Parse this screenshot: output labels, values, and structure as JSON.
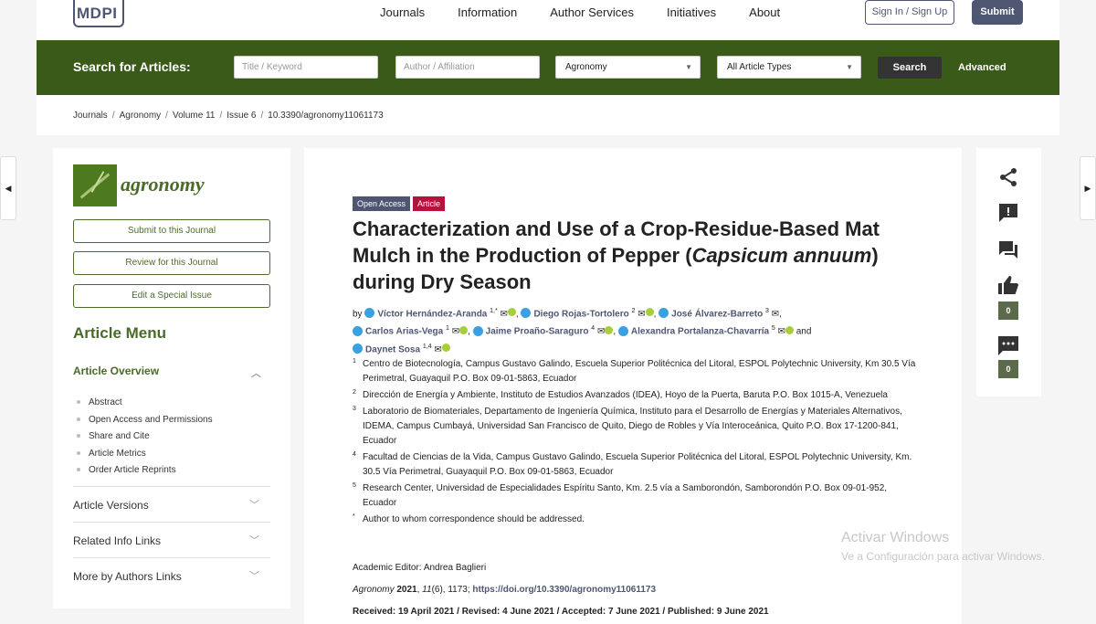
{
  "header": {
    "logo_text": "MDPI",
    "nav": [
      "Journals",
      "Information",
      "Author Services",
      "Initiatives",
      "About"
    ],
    "signin_label": "Sign In / Sign Up",
    "submit_label": "Submit"
  },
  "search": {
    "label": "Search for Articles:",
    "title_placeholder": "Title / Keyword",
    "author_placeholder": "Author / Affiliation",
    "journal_value": "Agronomy",
    "type_value": "All Article Types",
    "search_button": "Search",
    "advanced_link": "Advanced"
  },
  "breadcrumb": [
    "Journals",
    "Agronomy",
    "Volume 11",
    "Issue 6",
    "10.3390/agronomy11061173"
  ],
  "sidebar": {
    "journal_name": "agronomy",
    "buttons": [
      "Submit to this Journal",
      "Review for this Journal",
      "Edit a Special Issue"
    ],
    "menu_title": "Article Menu",
    "overview_title": "Article Overview",
    "overview_items": [
      "Abstract",
      "Open Access and Permissions",
      "Share and Cite",
      "Article Metrics",
      "Order Article Reprints"
    ],
    "collapsed_sections": [
      "Article Versions",
      "Related Info Links",
      "More by Authors Links"
    ]
  },
  "article": {
    "badge_open_access": "Open Access",
    "badge_type": "Article",
    "title_part1": "Characterization and Use of a Crop-Residue-Based Mat Mulch in the Production of Pepper (",
    "title_italic": "Capsicum annuum",
    "title_part2": ") during Dry Season",
    "by_label": "by",
    "and_label": "and",
    "authors": [
      {
        "name": "Víctor Hernández-Aranda",
        "sup": "1,*"
      },
      {
        "name": "Diego Rojas-Tortolero",
        "sup": "2"
      },
      {
        "name": "José Álvarez-Barreto",
        "sup": "3"
      },
      {
        "name": "Carlos Arias-Vega",
        "sup": "1"
      },
      {
        "name": "Jaime Proaño-Saraguro",
        "sup": "4"
      },
      {
        "name": "Alexandra Portalanza-Chavarría",
        "sup": "5"
      },
      {
        "name": "Daynet Sosa",
        "sup": "1,4"
      }
    ],
    "affiliations": [
      {
        "num": "1",
        "text": "Centro de Biotecnología, Campus Gustavo Galindo, Escuela Superior Politécnica del Litoral, ESPOL Polytechnic University, Km 30.5 Vía Perimetral, Guayaquil P.O. Box 09-01-5863, Ecuador"
      },
      {
        "num": "2",
        "text": "Dirección de Energía y Ambiente, Instituto de Estudios Avanzados (IDEA), Hoyo de la Puerta, Baruta P.O. Box 1015-A, Venezuela"
      },
      {
        "num": "3",
        "text": "Laboratorio de Biomateriales, Departamento de Ingeniería Química, Instituto para el Desarrollo de Energías y Materiales Alternativos, IDEMA, Campus Cumbayá, Universidad San Francisco de Quito, Diego de Robles y Vía Interoceánica, Quito P.O. Box 17-1200-841, Ecuador"
      },
      {
        "num": "4",
        "text": "Facultad de Ciencias de la Vida, Campus Gustavo Galindo, Escuela Superior Politécnica del Litoral, ESPOL Polytechnic University, Km. 30.5 Vía Perimetral, Guayaquil P.O. Box 09-01-5863, Ecuador"
      },
      {
        "num": "5",
        "text": "Research Center, Universidad de Especialidades Espíritu Santo, Km. 2.5 vía a Samborondón, Samborondón P.O. Box 09-01-952, Ecuador"
      },
      {
        "num": "*",
        "text": "Author to whom correspondence should be addressed."
      }
    ],
    "academic_editor": "Academic Editor: Andrea Baglieri",
    "citation_journal": "Agronomy",
    "citation_year": "2021",
    "citation_volume": "11",
    "citation_rest": "(6), 1173;",
    "citation_doi": "https://doi.org/10.3390/agronomy11061173",
    "dates": "Received: 19 April 2021 / Revised: 4 June 2021 / Accepted: 7 June 2021 / Published: 9 June 2021"
  },
  "toolbar": {
    "likes_count": "0",
    "comments_count": "0",
    "icons": [
      "share-icon",
      "report-icon",
      "chat-icon",
      "thumbs-up-icon",
      "comment-icon"
    ]
  },
  "watermark": {
    "line1": "Activar Windows",
    "line2": "Ve a Configuración para activar Windows."
  },
  "colors": {
    "brand": "#4f5671",
    "search_bar": "#3a5a1a",
    "journal_green": "#4a6a2a",
    "article_badge": "#b5123c"
  }
}
